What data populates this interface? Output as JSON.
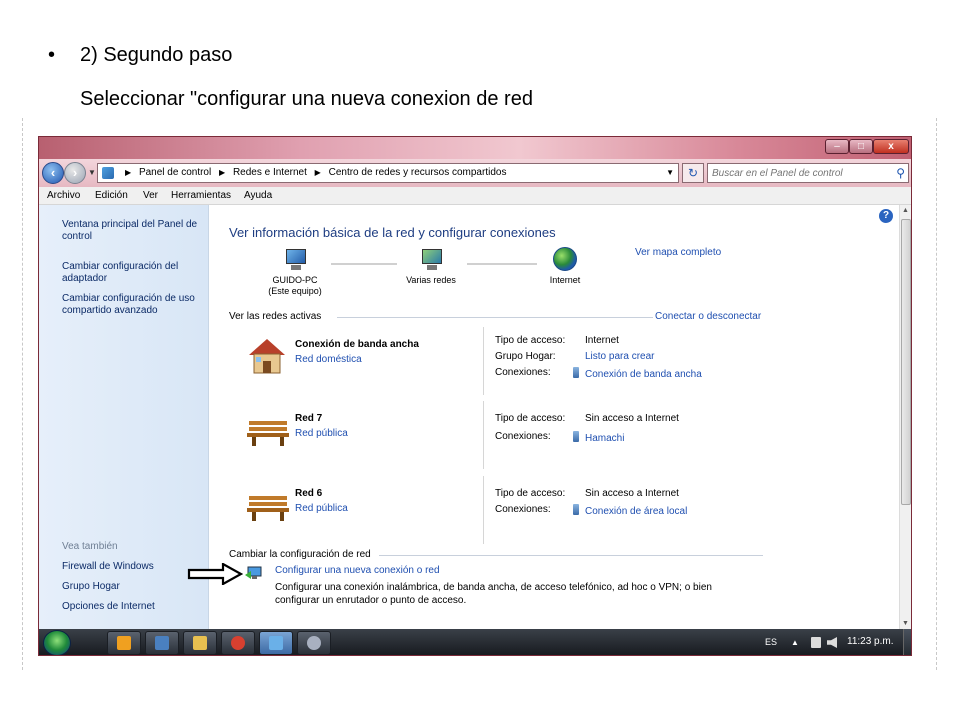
{
  "slide": {
    "bullet": "•",
    "title": "2) Segundo paso",
    "subtitle": "Seleccionar \"configurar una nueva conexion de red"
  },
  "window": {
    "buttons": {
      "minimize": "–",
      "maximize": "□",
      "close": "x"
    }
  },
  "address_bar": {
    "breadcrumbs": [
      "Panel de control",
      "Redes e Internet",
      "Centro de redes y recursos compartidos"
    ],
    "search_placeholder": "Buscar en el Panel de control"
  },
  "menu": [
    "Archivo",
    "Edición",
    "Ver",
    "Herramientas",
    "Ayuda"
  ],
  "sidebar": {
    "links": [
      "Ventana principal del Panel de control",
      "Cambiar configuración del adaptador",
      "Cambiar configuración de uso compartido avanzado"
    ],
    "see_also_label": "Vea también",
    "see_also": [
      "Firewall de Windows",
      "Grupo Hogar",
      "Opciones de Internet"
    ]
  },
  "main": {
    "title": "Ver información básica de la red y configurar conexiones",
    "map_link": "Ver mapa completo",
    "map_nodes": [
      {
        "label": "GUIDO-PC",
        "sublabel": "(Este equipo)"
      },
      {
        "label": "Varias redes",
        "sublabel": ""
      },
      {
        "label": "Internet",
        "sublabel": ""
      }
    ],
    "active_header": "Ver las redes activas",
    "connect_link": "Conectar o desconectar",
    "networks": [
      {
        "name": "Conexión de banda ancha",
        "type": "Red doméstica",
        "props": [
          {
            "label": "Tipo de acceso:",
            "value": "Internet",
            "link": false,
            "plug": false
          },
          {
            "label": "Grupo Hogar:",
            "value": "Listo para crear",
            "link": true,
            "plug": false
          },
          {
            "label": "Conexiones:",
            "value": "Conexión de banda ancha",
            "link": true,
            "plug": true
          }
        ]
      },
      {
        "name": "Red  7",
        "type": "Red pública",
        "props": [
          {
            "label": "Tipo de acceso:",
            "value": "Sin acceso a Internet",
            "link": false,
            "plug": false
          },
          {
            "label": "Conexiones:",
            "value": "Hamachi",
            "link": true,
            "plug": true
          }
        ]
      },
      {
        "name": "Red  6",
        "type": "Red pública",
        "props": [
          {
            "label": "Tipo de acceso:",
            "value": "Sin acceso a Internet",
            "link": false,
            "plug": false
          },
          {
            "label": "Conexiones:",
            "value": "Conexión de área local",
            "link": true,
            "plug": true
          }
        ]
      }
    ],
    "change_header": "Cambiar la configuración de red",
    "task_link": "Configurar una nueva conexión o red",
    "task_desc": "Configurar una conexión inalámbrica, de banda ancha, de acceso telefónico, ad hoc o VPN; o bien configurar un enrutador o punto de acceso."
  },
  "taskbar": {
    "language": "ES",
    "clock": "11:23 p.m."
  }
}
